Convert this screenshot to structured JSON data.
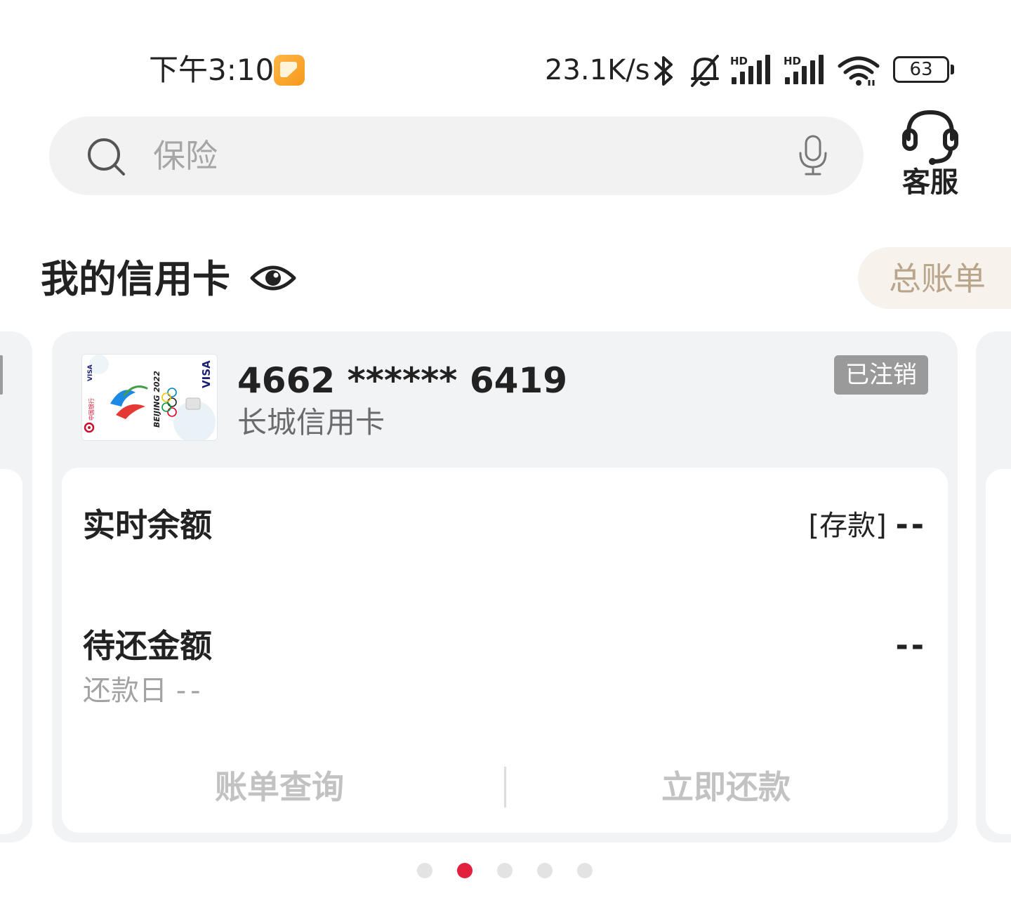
{
  "status_bar": {
    "time": "下午3:10",
    "network_speed": "23.1K/s",
    "battery": "63",
    "icons": [
      "app-notification-icon",
      "bluetooth-icon",
      "mute-bell-icon",
      "hd-signal-icon",
      "hd-signal-icon",
      "wifi-icon",
      "battery-icon"
    ]
  },
  "search": {
    "placeholder": "保险"
  },
  "service": {
    "label": "客服"
  },
  "section": {
    "title": "我的信用卡",
    "summary_button": "总账单"
  },
  "card": {
    "number": "4662 ****** 6419",
    "name": "长城信用卡",
    "status": "已注销",
    "balance_label": "实时余额",
    "balance_type": "[存款]",
    "balance_value": "--",
    "due_label": "待还金额",
    "due_value": "--",
    "due_date_label": "还款日",
    "due_date_value": "--",
    "action_bill": "账单查询",
    "action_pay": "立即还款",
    "thumbnail": {
      "bank": "中国银行",
      "event": "BEIJING 2022",
      "network": "VISA"
    }
  },
  "pager": {
    "total": 5,
    "active_index": 1
  },
  "colors": {
    "accent": "#e0203d",
    "card_bg": "#f2f3f5",
    "status_badge": "#9a9a9a",
    "summary_text": "#b9a58b",
    "disabled_action": "#c2c2c2"
  }
}
